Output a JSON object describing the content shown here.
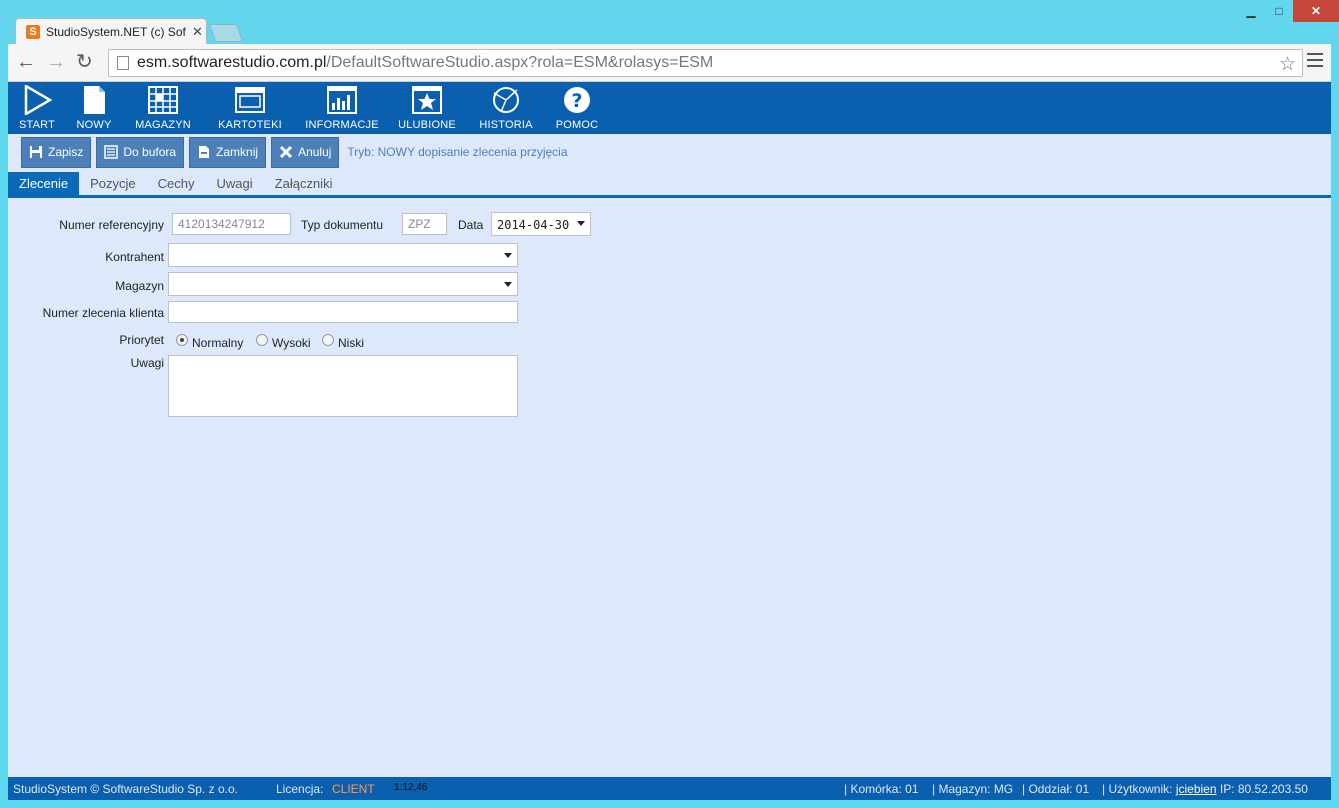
{
  "browser": {
    "tab_title": "StudioSystem.NET (c) Soft",
    "url_host": "esm.softwarestudio.com.pl",
    "url_rest": "/DefaultSoftwareStudio.aspx?rola=ESM&rolasys=ESM"
  },
  "appbar": {
    "items": [
      {
        "label": "START",
        "icon": "play-icon"
      },
      {
        "label": "NOWY",
        "icon": "new-document-icon"
      },
      {
        "label": "MAGAZYN",
        "icon": "warehouse-grid-icon"
      },
      {
        "label": "KARTOTEKI",
        "icon": "cards-icon"
      },
      {
        "label": "INFORMACJE",
        "icon": "chart-icon"
      },
      {
        "label": "ULUBIONE",
        "icon": "star-icon"
      },
      {
        "label": "HISTORIA",
        "icon": "history-icon"
      },
      {
        "label": "POMOC",
        "icon": "help-icon"
      }
    ]
  },
  "actions": {
    "save": "Zapisz",
    "buffer": "Do bufora",
    "close": "Zamknij",
    "cancel": "Anuluj",
    "mode": "Tryb: NOWY dopisanie zlecenia przyjęcia"
  },
  "tabs": [
    "Zlecenie",
    "Pozycje",
    "Cechy",
    "Uwagi",
    "Załączniki"
  ],
  "form": {
    "ref_label": "Numer referencyjny",
    "ref_value": "4120134247912",
    "doctype_label": "Typ dokumentu",
    "doctype_value": "ZPZ",
    "date_label": "Data",
    "date_value": "2014-04-30",
    "contractor_label": "Kontrahent",
    "warehouse_label": "Magazyn",
    "client_order_label": "Numer zlecenia klienta",
    "priority_label": "Priorytet",
    "priority_options": [
      "Normalny",
      "Wysoki",
      "Niski"
    ],
    "priority_selected": "Normalny",
    "notes_label": "Uwagi"
  },
  "status": {
    "copyright": "StudioSystem © SoftwareStudio Sp. z o.o.",
    "license_label": "Licencja:",
    "license_value": "CLIENT",
    "timer": "1:12,46",
    "cell": "Komórka: 01",
    "warehouse": "Magazyn: MG",
    "branch": "Oddział: 01",
    "user_label": "Użytkownik:",
    "user": "jciebien",
    "ip": "IP: 80.52.203.50"
  },
  "colors": {
    "appbar": "#0a5faf",
    "background": "#dde9fb",
    "button": "#4d80b8",
    "license": "#ff9a3c"
  }
}
